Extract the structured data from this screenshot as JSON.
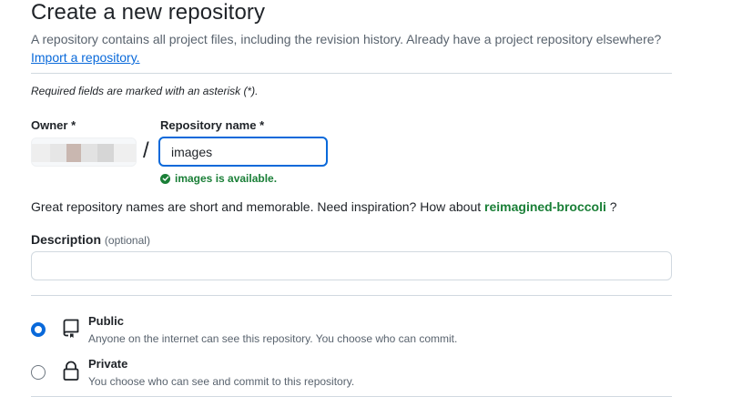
{
  "header": {
    "title": "Create a new repository",
    "subtitle": "A repository contains all project files, including the revision history. Already have a project repository elsewhere?",
    "import_link": "Import a repository."
  },
  "form": {
    "required_note": "Required fields are marked with an asterisk (*).",
    "owner_label": "Owner",
    "owner_required": "*",
    "slash": "/",
    "repo_name_label": "Repository name",
    "repo_name_required": "*",
    "repo_name_value": "images",
    "availability": "images is available.",
    "inspiration_text": "Great repository names are short and memorable. Need inspiration? How about",
    "suggestion": "reimagined-broccoli",
    "inspiration_end": "?",
    "description_label": "Description",
    "description_optional": "(optional)",
    "description_value": ""
  },
  "visibility": {
    "selected": "Public",
    "options": [
      {
        "title": "Public",
        "description": "Anyone on the internet can see this repository. You choose who can commit.",
        "icon": "repo-icon"
      },
      {
        "title": "Private",
        "description": "You choose who can see and commit to this repository.",
        "icon": "lock-icon"
      }
    ]
  },
  "colors": {
    "accent": "#0969da",
    "success": "#1a7f37",
    "muted": "#59636e",
    "border": "#d1d9e0"
  }
}
